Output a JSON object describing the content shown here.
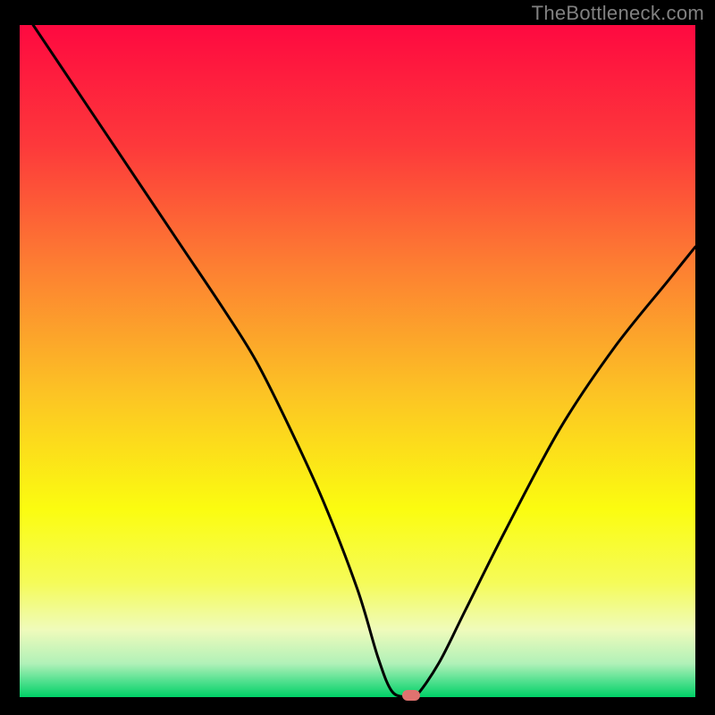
{
  "watermark": "TheBottleneck.com",
  "colors": {
    "frame": "#000000",
    "gradient_stops": [
      {
        "offset": 0.0,
        "color": "#fe0940"
      },
      {
        "offset": 0.18,
        "color": "#fd393b"
      },
      {
        "offset": 0.36,
        "color": "#fd7f32"
      },
      {
        "offset": 0.55,
        "color": "#fcc424"
      },
      {
        "offset": 0.72,
        "color": "#fbfc10"
      },
      {
        "offset": 0.83,
        "color": "#f5fb59"
      },
      {
        "offset": 0.9,
        "color": "#effbbb"
      },
      {
        "offset": 0.95,
        "color": "#b1f1b8"
      },
      {
        "offset": 0.975,
        "color": "#56e191"
      },
      {
        "offset": 1.0,
        "color": "#00d166"
      }
    ],
    "curve": "#000000",
    "marker": "#e0726f"
  },
  "chart_data": {
    "type": "line",
    "title": "",
    "xlabel": "",
    "ylabel": "",
    "xlim": [
      0,
      100
    ],
    "ylim": [
      0,
      100
    ],
    "series": [
      {
        "name": "bottleneck-curve",
        "x": [
          2,
          6,
          12,
          18,
          24,
          30,
          35,
          40,
          45,
          50,
          53,
          55,
          57,
          58.5,
          62,
          66,
          72,
          80,
          88,
          96,
          100
        ],
        "y": [
          100,
          94,
          85,
          76,
          67,
          58,
          50,
          40,
          29,
          16,
          6,
          1,
          0,
          0,
          5,
          13,
          25,
          40,
          52,
          62,
          67
        ]
      }
    ],
    "markers": [
      {
        "name": "optimal-point",
        "x": 58,
        "y": 0
      }
    ]
  }
}
